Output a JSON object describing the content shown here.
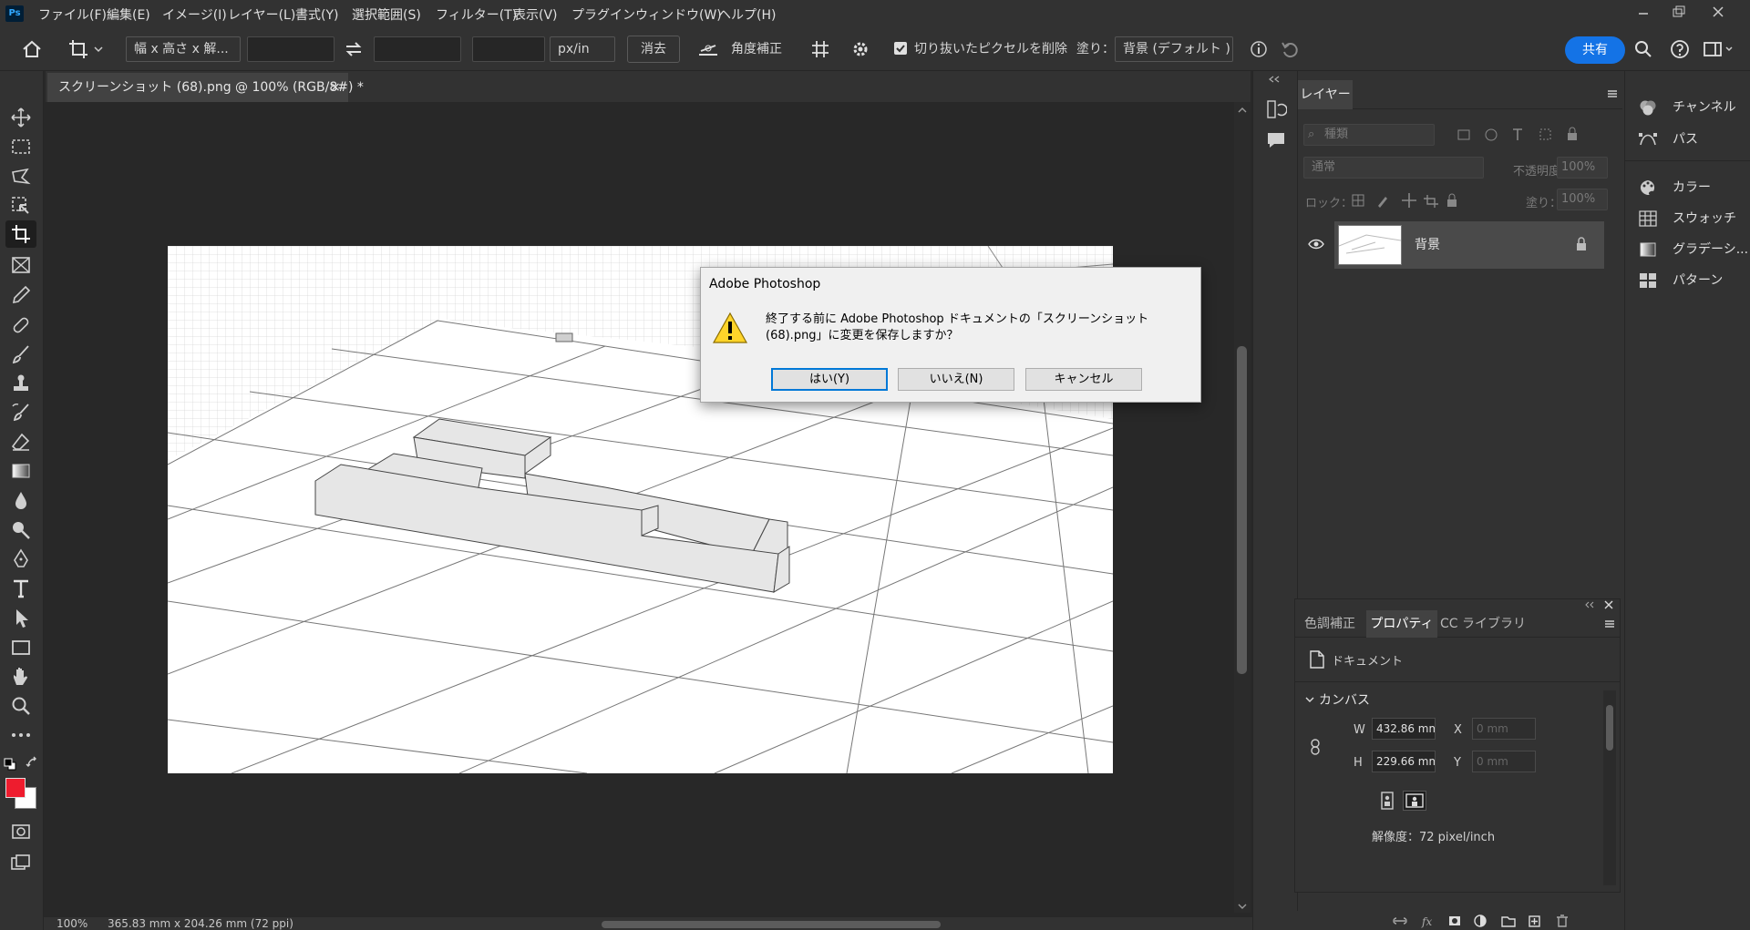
{
  "app": {
    "logo": "Ps"
  },
  "menu": [
    "ファイル(F)",
    "編集(E)",
    "イメージ(I)",
    "レイヤー(L)",
    "書式(Y)",
    "選択範囲(S)",
    "フィルター(T)",
    "表示(V)",
    "プラグイン",
    "ウィンドウ(W)",
    "ヘルプ(H)"
  ],
  "options": {
    "ratio_select": "幅 x 高さ x 解...",
    "width_value": "",
    "height_value": "",
    "resolution_value": "",
    "unit_select": "px/in",
    "clear_label": "消去",
    "straighten_label": "角度補正",
    "delete_cropped_label": "切り抜いたピクセルを削除",
    "fill_label": "塗り：",
    "fill_select": "背景 (デフォルト )",
    "share_label": "共有"
  },
  "document": {
    "tab_title": "スクリーンショット (68).png @ 100% (RGB/8#) *",
    "zoom": "100%",
    "size_info": "365.83 mm x 204.26 mm (72 ppi)"
  },
  "dialog": {
    "title": "Adobe Photoshop",
    "message": "終了する前に Adobe Photoshop ドキュメントの「スクリーンショット (68).png」に変更を保存しますか？",
    "yes": "はい(Y)",
    "no": "いいえ(N)",
    "cancel": "キャンセル"
  },
  "layers": {
    "tab": "レイヤー",
    "filter_placeholder": "種類",
    "blend_mode": "通常",
    "opacity_label": "不透明度：",
    "opacity_value": "100%",
    "lock_label": "ロック：",
    "fill_label": "塗り：",
    "fill_value": "100%",
    "items": [
      {
        "name": "背景",
        "locked": true,
        "visible": true
      }
    ]
  },
  "right_panels": [
    "チャンネル",
    "パス",
    "カラー",
    "スウォッチ",
    "グラデーシ...",
    "パターン"
  ],
  "properties": {
    "tabs": [
      "色調補正",
      "プロパティ",
      "CC ライブラリ"
    ],
    "doc_label": "ドキュメント",
    "section": "カンバス",
    "w_label": "W",
    "w_value": "432.86 mm",
    "h_label": "H",
    "h_value": "229.66 mm",
    "x_label": "X",
    "x_placeholder": "0 mm",
    "y_label": "Y",
    "y_placeholder": "0 mm",
    "resolution": "解像度：72 pixel/inch"
  },
  "colors": {
    "foreground": "#ee1c2e",
    "background": "#ffffff",
    "accent": "#1473e6"
  }
}
